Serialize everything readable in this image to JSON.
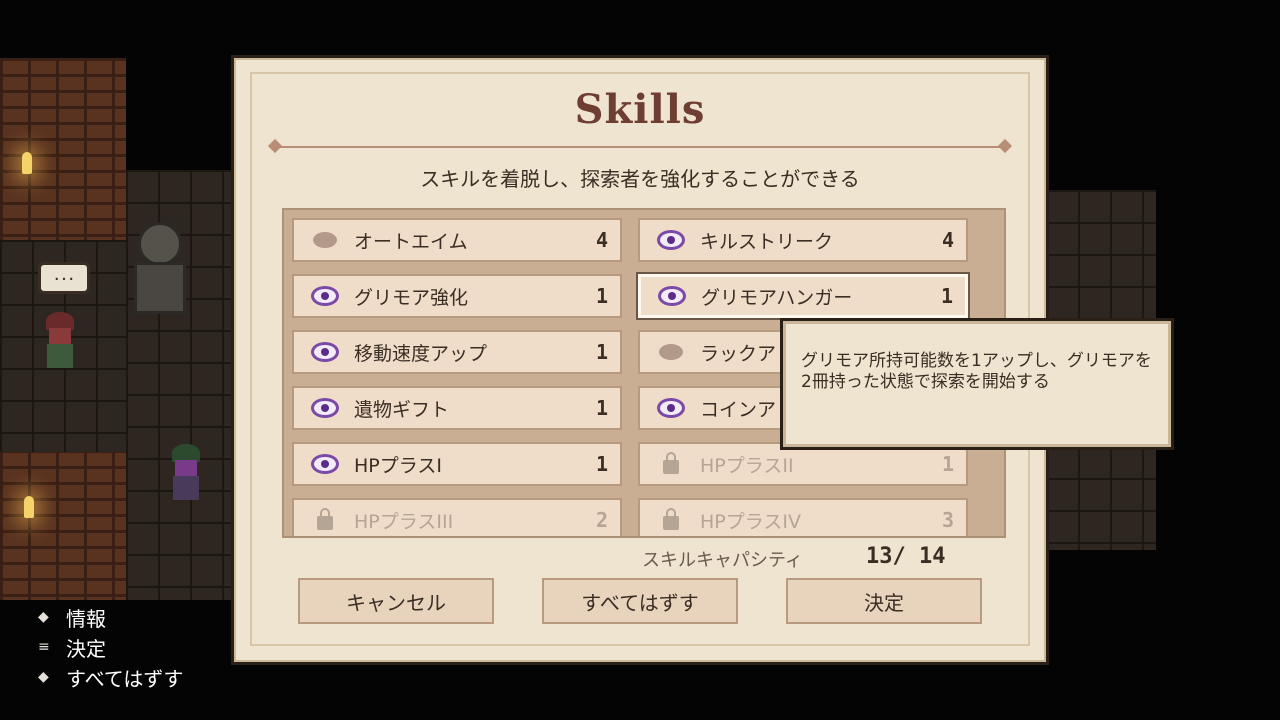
{
  "panel": {
    "title": "Skills",
    "subtitle": "スキルを着脱し、探索者を強化することができる"
  },
  "skills": [
    {
      "name": "オートエイム",
      "cost": "4",
      "icon": "blob-icon",
      "state": "inactive"
    },
    {
      "name": "キルストリーク",
      "cost": "4",
      "icon": "eye-icon",
      "state": "equipped"
    },
    {
      "name": "グリモア強化",
      "cost": "1",
      "icon": "eye-icon",
      "state": "equipped"
    },
    {
      "name": "グリモアハンガー",
      "cost": "1",
      "icon": "eye-icon",
      "state": "equipped"
    },
    {
      "name": "移動速度アップ",
      "cost": "1",
      "icon": "eye-icon",
      "state": "equipped"
    },
    {
      "name": "ラックア",
      "cost": "",
      "icon": "blob-icon",
      "state": "inactive"
    },
    {
      "name": "遺物ギフト",
      "cost": "1",
      "icon": "eye-icon",
      "state": "equipped"
    },
    {
      "name": "コインア",
      "cost": "",
      "icon": "eye-icon",
      "state": "equipped"
    },
    {
      "name": "HPプラスI",
      "cost": "1",
      "icon": "eye-icon",
      "state": "equipped"
    },
    {
      "name": "HPプラスII",
      "cost": "1",
      "icon": "lock-icon",
      "state": "locked"
    },
    {
      "name": "HPプラスIII",
      "cost": "2",
      "icon": "lock-icon",
      "state": "locked"
    },
    {
      "name": "HPプラスIV",
      "cost": "3",
      "icon": "lock-icon",
      "state": "locked"
    }
  ],
  "selected_skill": "グリモアハンガー",
  "tooltip": {
    "text": "グリモア所持可能数を1アップし、グリモアを2冊持った状態で探索を開始する"
  },
  "capacity": {
    "label": "スキルキャパシティ",
    "value": "13/ 14"
  },
  "buttons": {
    "cancel": "キャンセル",
    "remove_all": "すべてはずす",
    "confirm": "決定"
  },
  "hints": [
    {
      "key_icon": "diamond-icon",
      "label": "情報"
    },
    {
      "key_icon": "menu-icon",
      "label": "決定"
    },
    {
      "key_icon": "diamond-icon",
      "label": "すべてはずす"
    }
  ],
  "npc_bubble": "..."
}
